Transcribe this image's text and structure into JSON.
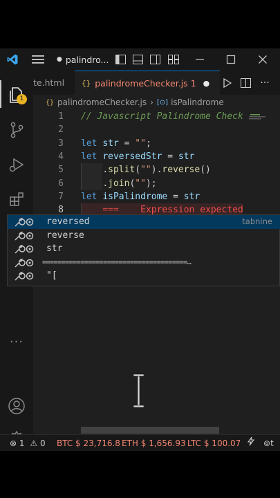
{
  "titlebar": {
    "title": "palindro..."
  },
  "tabs": [
    {
      "label": "te.html"
    },
    {
      "label": "palindromeChecker.js",
      "badge": "1"
    }
  ],
  "explorer_badge": "1",
  "breadcrumb": {
    "file": "palindromeChecker.js",
    "symbol": "isPalindrome"
  },
  "editor": {
    "line_numbers": [
      "1",
      "2",
      "3",
      "4",
      "5",
      "6",
      "7",
      "8"
    ],
    "comment": "// Javascript Palindrome Check",
    "l3_kw": "let",
    "l3_var": "str",
    "l3_eq": " = ",
    "l3_str": "\"\"",
    "l3_semi": ";",
    "l4_kw": "let",
    "l4_var": "reversedStr",
    "l4_eq": " = ",
    "l4_str_var": "str",
    "l5_dot": ".",
    "l5_fn": "split",
    "l5_open": "(",
    "l5_str": "\"\"",
    "l5_close": ").",
    "l5_fn2": "reverse",
    "l5_paren": "()",
    "l6_dot": ".",
    "l6_fn": "join",
    "l6_open": "(",
    "l6_str": "\"\"",
    "l6_close": ");",
    "l7_kw": "let",
    "l7_var": "isPalindrome",
    "l7_eq": " = ",
    "l7_str_var": "str",
    "l8_op": "===",
    "error_hover": "Expression expected"
  },
  "suggestions": [
    {
      "label": "reversed",
      "source": "tabnine"
    },
    {
      "label": "reverse",
      "source": ""
    },
    {
      "label": "str",
      "source": ""
    },
    {
      "label": "======================================…",
      "source": ""
    },
    {
      "label": "\"[",
      "source": ""
    }
  ],
  "statusbar": {
    "errors": "1",
    "warnings": "0",
    "btc": "BTC $ 23,716.8",
    "eth": "ETH $ 1,656.93",
    "ltc": "LTC $ 100.07",
    "trail": "t"
  },
  "colors": {
    "accent": "#f48771",
    "badge": "#e8b325",
    "activity_active": "#ffffff"
  }
}
